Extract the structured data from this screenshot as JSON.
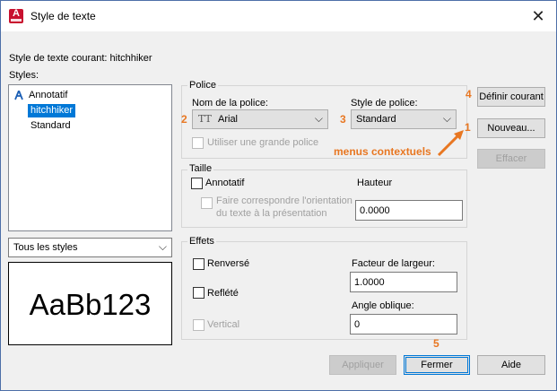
{
  "window": {
    "title": "Style de texte",
    "app_icon_letter": "A",
    "close_glyph": "✕"
  },
  "current_style": "Style de texte courant: hitchhiker",
  "styles": {
    "label": "Styles:",
    "items": [
      {
        "label": "Annotatif",
        "icon": "annotative-icon",
        "selected": false
      },
      {
        "label": "hitchhiker",
        "selected": true
      },
      {
        "label": "Standard",
        "selected": false
      }
    ]
  },
  "filter_select": {
    "value": "Tous les styles"
  },
  "preview_text": "AaBb123",
  "police": {
    "group_title": "Police",
    "font_name_label": "Nom de la police:",
    "font_name_value": "Arial",
    "font_type_glyph": "TT",
    "font_style_label": "Style de police:",
    "font_style_value": "Standard",
    "big_font_label": "Utiliser une grande police"
  },
  "taille": {
    "group_title": "Taille",
    "annotative_label": "Annotatif",
    "match_orientation_label_line1": "Faire correspondre l'orientation",
    "match_orientation_label_line2": "du texte à la présentation",
    "height_label": "Hauteur",
    "height_value": "0.0000"
  },
  "effets": {
    "group_title": "Effets",
    "upside_down_label": "Renversé",
    "backwards_label": "Reflété",
    "vertical_label": "Vertical",
    "width_factor_label": "Facteur de largeur:",
    "width_factor_value": "1.0000",
    "oblique_label": "Angle oblique:",
    "oblique_value": "0"
  },
  "buttons": {
    "set_current": "Définir courant",
    "new": "Nouveau...",
    "delete": "Effacer",
    "apply": "Appliquer",
    "close": "Fermer",
    "help": "Aide"
  },
  "callouts": {
    "n1": "1",
    "n2": "2",
    "n3": "3",
    "n4": "4",
    "n5": "5",
    "menus": "menus contextuels"
  },
  "colors": {
    "accent": "#e87722",
    "selection": "#0078d7",
    "brand_red": "#c8102e"
  }
}
